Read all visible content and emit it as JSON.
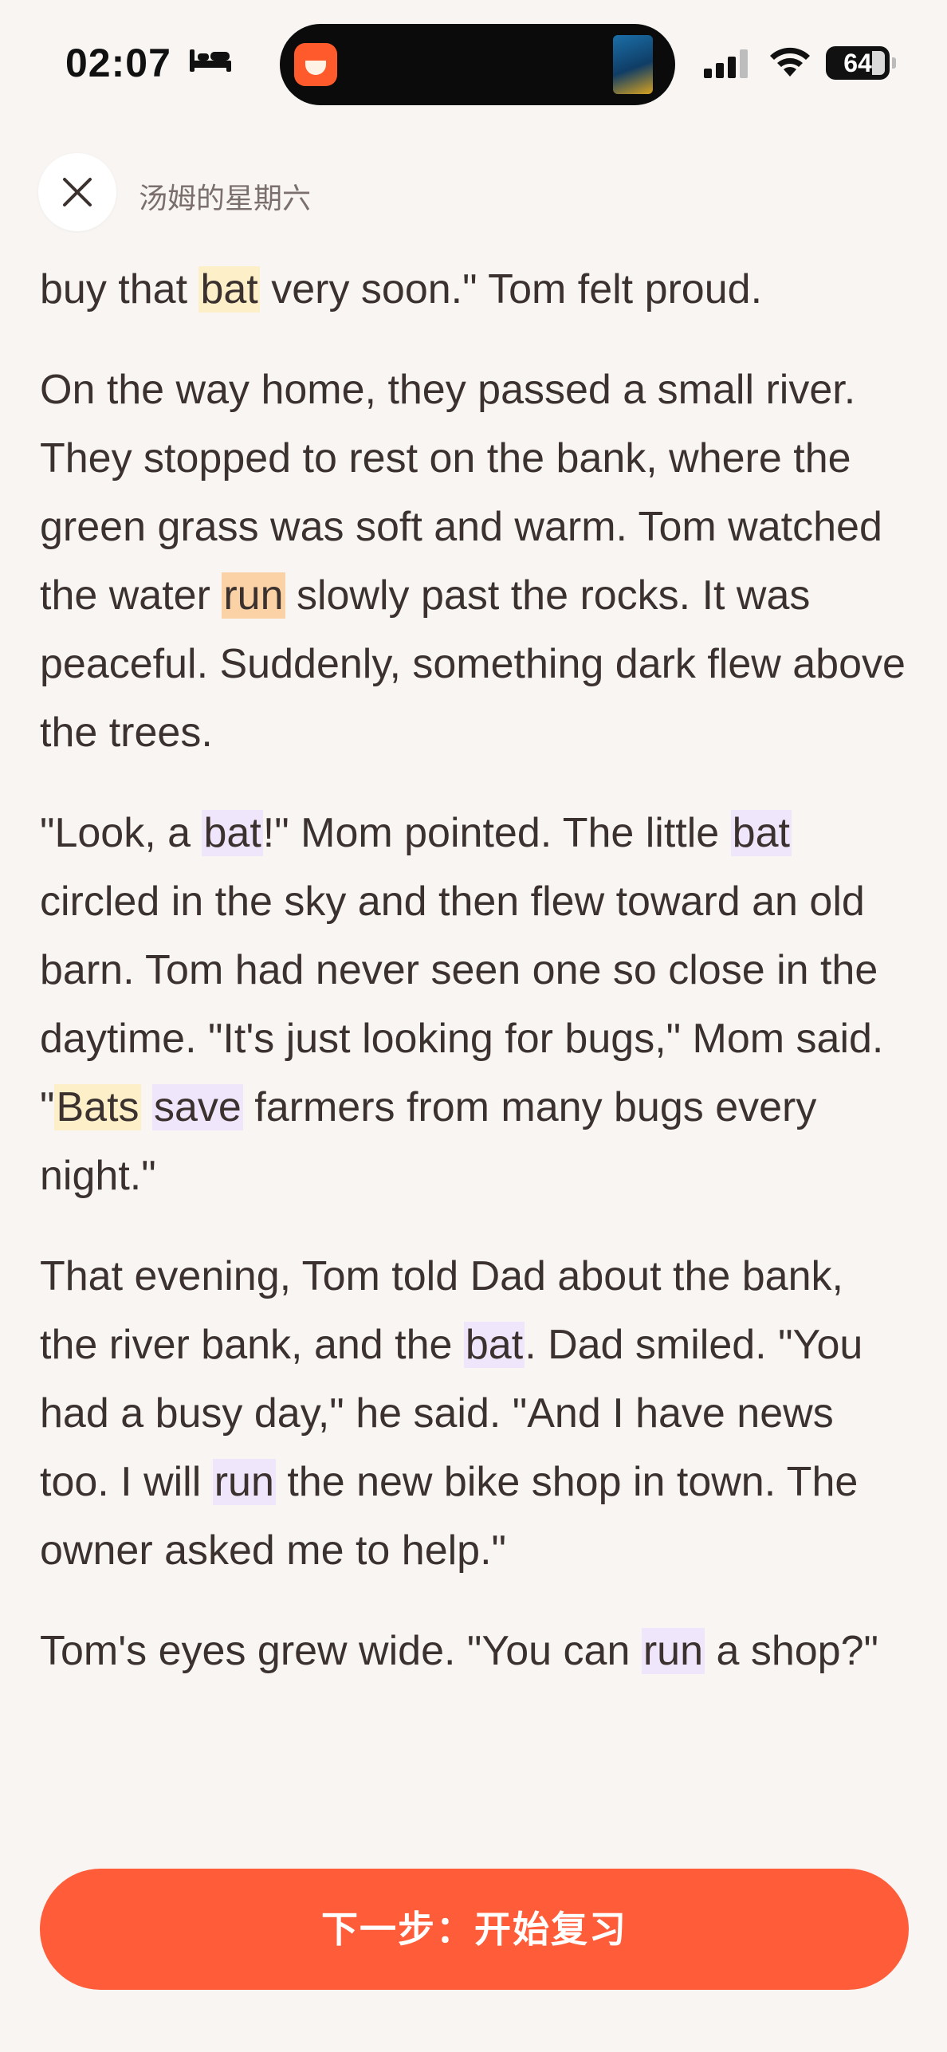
{
  "status_bar": {
    "time": "02:07",
    "battery": "64"
  },
  "header": {
    "title": "汤姆的星期六"
  },
  "reading": {
    "p1": {
      "t1": "buy that ",
      "w1": "bat",
      "t2": " very soon.\" Tom felt proud."
    },
    "p2": {
      "t1": "On the way home, they passed a small river. They stopped to rest on the bank, where the green grass was soft and warm. Tom watched the water ",
      "w1": "run",
      "t2": " slowly past the rocks. It was peaceful. Suddenly, something dark flew above the trees."
    },
    "p3": {
      "t1": "\"Look, a ",
      "w1": "bat",
      "t2": "!\" Mom pointed. The little ",
      "w2": "bat",
      "t3": " circled in the sky and then flew toward an old barn. Tom had never seen one so close in the daytime. \"It's just looking for bugs,\" Mom said. \"",
      "w3": "Bats",
      "t4": " ",
      "w4": "save",
      "t5": " farmers from many bugs every night.\""
    },
    "p4": {
      "t1": "That evening, Tom told Dad about the bank, the river bank, and the ",
      "w1": "bat",
      "t2": ". Dad smiled. \"You had a busy day,\" he said. \"And I have news too. I will ",
      "w2": "run",
      "t3": " the new bike shop in town. The owner asked me to help.\""
    },
    "p5": {
      "t1": "Tom's eyes grew wide. \"You can ",
      "w1": "run",
      "t2": " a shop?\""
    }
  },
  "footer": {
    "next_button": "下一步：开始复习"
  },
  "colors": {
    "accent": "#ff5d3a",
    "highlight_yellow": "#fdf0c8",
    "highlight_orange": "#fbd2a5",
    "highlight_purple": "#efe6fb"
  }
}
